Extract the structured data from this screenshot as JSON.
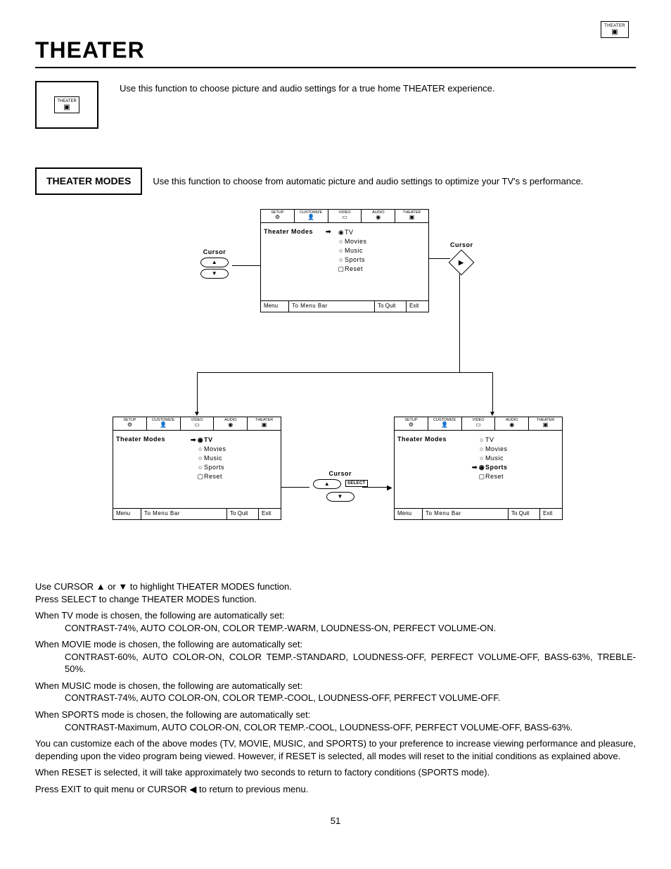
{
  "header": {
    "title": "THEATER",
    "icon_label": "THEATER"
  },
  "intro": {
    "icon_label": "THEATER",
    "text": "Use this function to choose picture and audio settings for a true home THEATER experience."
  },
  "modes_section": {
    "label": "THEATER MODES",
    "text": "Use this function to choose from automatic picture and audio settings to optimize your TV's s performance."
  },
  "osd": {
    "tabs": [
      "SETUP",
      "CUSTOMIZE",
      "VIDEO",
      "AUDIO",
      "THEATER"
    ],
    "left_label": "Theater Modes",
    "options": [
      "TV",
      "Movies",
      "Music",
      "Sports",
      "Reset"
    ],
    "footer": {
      "f1": "Menu",
      "f2": "To Menu Bar",
      "f3": "To Quit",
      "f4": "Exit"
    }
  },
  "cursor_label": "Cursor",
  "select_label": "SELECT",
  "instructions": {
    "line1a": "Use CURSOR ",
    "line1b": " or ",
    "line1c": " to highlight THEATER  MODES function.",
    "line2": "Press SELECT to change THEATER MODES function.",
    "tv_h": "When TV mode is chosen, the following are automatically set:",
    "tv_d": "CONTRAST-74%, AUTO COLOR-ON, COLOR TEMP.-WARM, LOUDNESS-ON, PERFECT VOLUME-ON.",
    "mv_h": "When MOVIE mode is chosen, the following are automatically set:",
    "mv_d": "CONTRAST-60%, AUTO COLOR-ON, COLOR TEMP.-STANDARD, LOUDNESS-OFF, PERFECT VOLUME-OFF, BASS-63%, TREBLE-50%.",
    "mu_h": "When MUSIC mode is chosen, the following are automatically set:",
    "mu_d": "CONTRAST-74%, AUTO COLOR-ON, COLOR TEMP.-COOL, LOUDNESS-OFF, PERFECT VOLUME-OFF.",
    "sp_h": "When SPORTS mode is chosen, the following are automatically set:",
    "sp_d": "CONTRAST-Maximum, AUTO COLOR-ON, COLOR TEMP.-COOL, LOUDNESS-OFF, PERFECT VOLUME-OFF, BASS-63%.",
    "cust": "You can customize each of the above modes (TV, MOVIE, MUSIC, and SPORTS) to your preference to increase viewing performance and pleasure, depending upon the video program being viewed. However, if RESET is selected, all modes will reset to the initial conditions as explained above.",
    "reset": "When RESET is selected, it will take approximately two seconds to return to factory conditions (SPORTS mode).",
    "exit_a": "Press EXIT to quit menu or CURSOR ",
    "exit_b": " to return to previous menu."
  },
  "page_number": "51"
}
